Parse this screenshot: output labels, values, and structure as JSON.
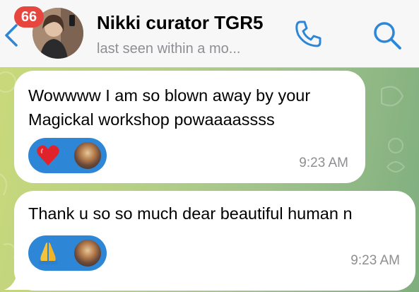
{
  "header": {
    "unread_count": "66",
    "contact_name": "Nikki curator TGR5",
    "status": "last seen within a mo...",
    "icons": [
      "back-chevron-icon",
      "phone-icon",
      "search-icon"
    ]
  },
  "messages": [
    {
      "text": "Wowwww I am so blown away by your Magickal workshop powaaaassss",
      "reaction_emoji": "red-heart",
      "time": "9:23 AM"
    },
    {
      "text": "Thank u so so much dear beautiful human n",
      "reaction_emoji": "folded-hands",
      "time": "9:23 AM"
    }
  ],
  "colors": {
    "accent": "#2d87d6",
    "badge": "#e7463f",
    "wallpaper_start": "#c9d97a",
    "wallpaper_end": "#7fae7e",
    "bubble": "#ffffff"
  }
}
